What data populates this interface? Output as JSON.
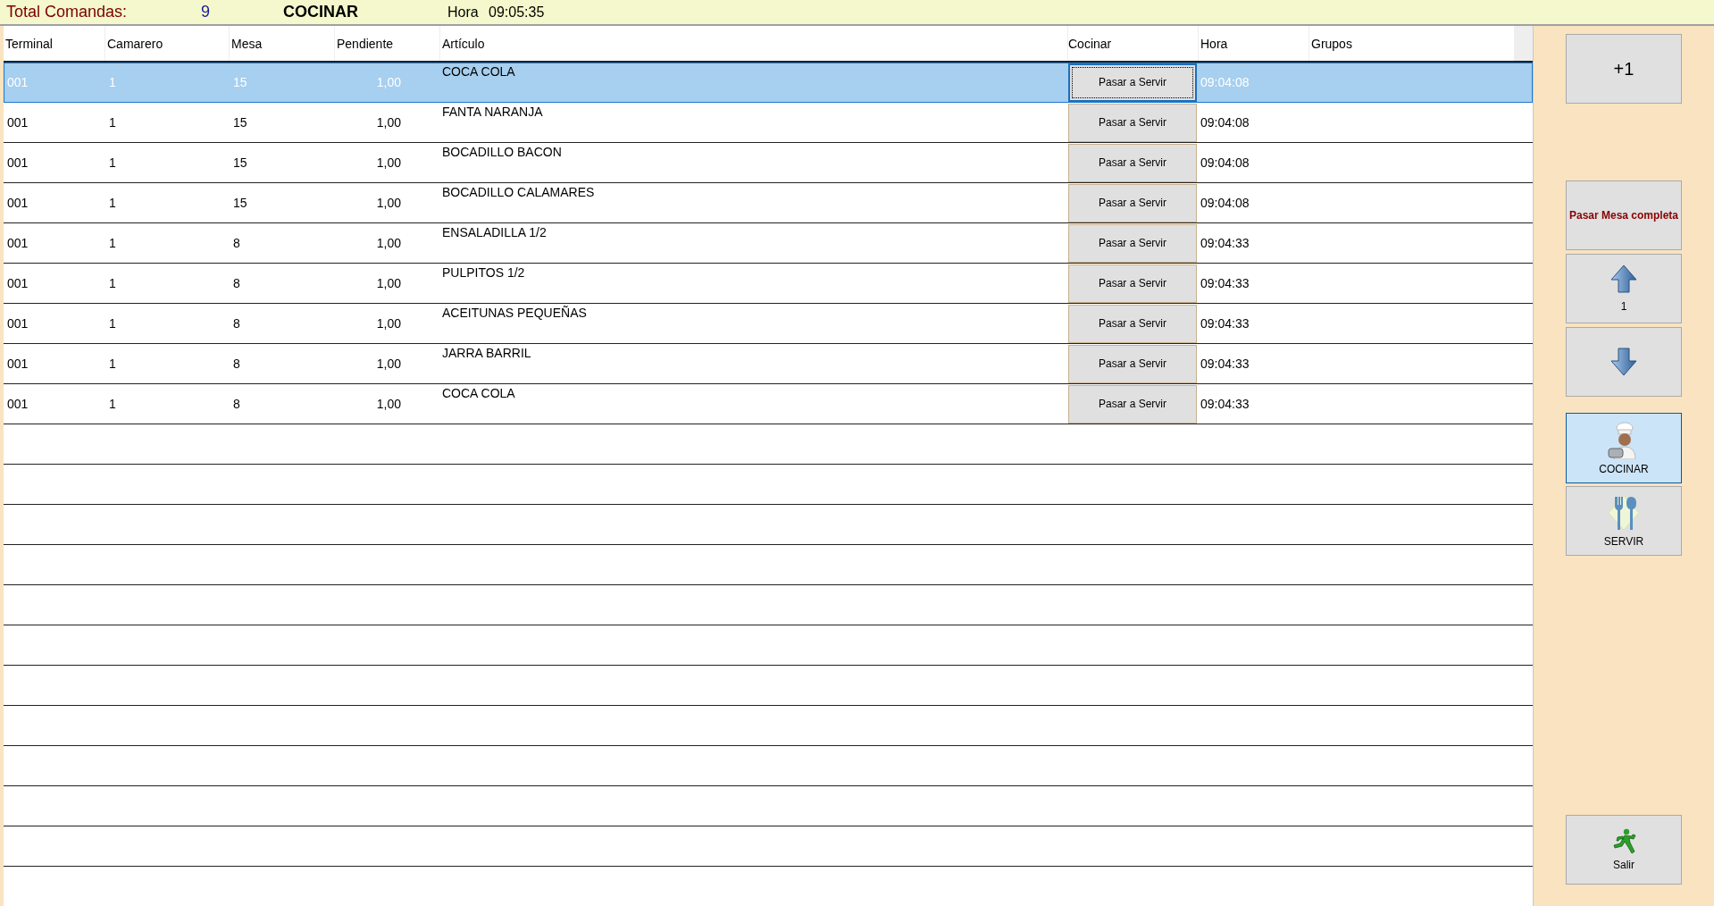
{
  "header": {
    "total_label": "Total Comandas:",
    "total_value": "9",
    "mode": "COCINAR",
    "time_label": "Hora",
    "time": "09:05:35"
  },
  "table": {
    "columns": [
      "Terminal",
      "Camarero",
      "Mesa",
      "Pendiente",
      "Artículo",
      "Cocinar",
      "Hora",
      "Grupos"
    ],
    "rows": [
      {
        "terminal": "001",
        "camarero": "1",
        "mesa": "15",
        "pendiente": "1,00",
        "articulo": "COCA COLA",
        "action": "Pasar a Servir",
        "hora": "09:04:08",
        "selected": true
      },
      {
        "terminal": "001",
        "camarero": "1",
        "mesa": "15",
        "pendiente": "1,00",
        "articulo": "FANTA NARANJA",
        "action": "Pasar a Servir",
        "hora": "09:04:08",
        "selected": false
      },
      {
        "terminal": "001",
        "camarero": "1",
        "mesa": "15",
        "pendiente": "1,00",
        "articulo": "BOCADILLO BACON",
        "action": "Pasar a Servir",
        "hora": "09:04:08",
        "selected": false
      },
      {
        "terminal": "001",
        "camarero": "1",
        "mesa": "15",
        "pendiente": "1,00",
        "articulo": "BOCADILLO CALAMARES",
        "action": "Pasar a Servir",
        "hora": "09:04:08",
        "selected": false
      },
      {
        "terminal": "001",
        "camarero": "1",
        "mesa": "8",
        "pendiente": "1,00",
        "articulo": "ENSALADILLA 1/2",
        "action": "Pasar a Servir",
        "hora": "09:04:33",
        "selected": false
      },
      {
        "terminal": "001",
        "camarero": "1",
        "mesa": "8",
        "pendiente": "1,00",
        "articulo": "PULPITOS 1/2",
        "action": "Pasar a Servir",
        "hora": "09:04:33",
        "selected": false
      },
      {
        "terminal": "001",
        "camarero": "1",
        "mesa": "8",
        "pendiente": "1,00",
        "articulo": "ACEITUNAS PEQUEÑAS",
        "action": "Pasar a Servir",
        "hora": "09:04:33",
        "selected": false
      },
      {
        "terminal": "001",
        "camarero": "1",
        "mesa": "8",
        "pendiente": "1,00",
        "articulo": "JARRA BARRIL",
        "action": "Pasar a Servir",
        "hora": "09:04:33",
        "selected": false
      },
      {
        "terminal": "001",
        "camarero": "1",
        "mesa": "8",
        "pendiente": "1,00",
        "articulo": "COCA COLA",
        "action": "Pasar a Servir",
        "hora": "09:04:33",
        "selected": false
      }
    ]
  },
  "sidebar": {
    "buttons": [
      {
        "kind": "plus",
        "label": "+1"
      },
      {
        "kind": "table",
        "label": "Pasar Mesa completa"
      },
      {
        "kind": "up",
        "label": "1"
      },
      {
        "kind": "down"
      },
      {
        "kind": "cook",
        "label": "COCINAR",
        "selected": true
      },
      {
        "kind": "serve",
        "label": "SERVIR",
        "selected": false
      },
      {
        "kind": "exit",
        "label": "Salir"
      }
    ]
  }
}
